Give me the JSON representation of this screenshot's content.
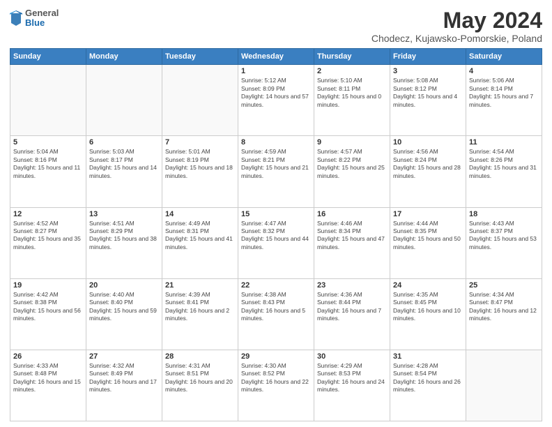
{
  "header": {
    "logo": {
      "general": "General",
      "blue": "Blue"
    },
    "title": "May 2024",
    "subtitle": "Chodecz, Kujawsko-Pomorskie, Poland"
  },
  "weekdays": [
    "Sunday",
    "Monday",
    "Tuesday",
    "Wednesday",
    "Thursday",
    "Friday",
    "Saturday"
  ],
  "weeks": [
    [
      {
        "day": "",
        "sunrise": "",
        "sunset": "",
        "daylight": ""
      },
      {
        "day": "",
        "sunrise": "",
        "sunset": "",
        "daylight": ""
      },
      {
        "day": "",
        "sunrise": "",
        "sunset": "",
        "daylight": ""
      },
      {
        "day": "1",
        "sunrise": "Sunrise: 5:12 AM",
        "sunset": "Sunset: 8:09 PM",
        "daylight": "Daylight: 14 hours and 57 minutes."
      },
      {
        "day": "2",
        "sunrise": "Sunrise: 5:10 AM",
        "sunset": "Sunset: 8:11 PM",
        "daylight": "Daylight: 15 hours and 0 minutes."
      },
      {
        "day": "3",
        "sunrise": "Sunrise: 5:08 AM",
        "sunset": "Sunset: 8:12 PM",
        "daylight": "Daylight: 15 hours and 4 minutes."
      },
      {
        "day": "4",
        "sunrise": "Sunrise: 5:06 AM",
        "sunset": "Sunset: 8:14 PM",
        "daylight": "Daylight: 15 hours and 7 minutes."
      }
    ],
    [
      {
        "day": "5",
        "sunrise": "Sunrise: 5:04 AM",
        "sunset": "Sunset: 8:16 PM",
        "daylight": "Daylight: 15 hours and 11 minutes."
      },
      {
        "day": "6",
        "sunrise": "Sunrise: 5:03 AM",
        "sunset": "Sunset: 8:17 PM",
        "daylight": "Daylight: 15 hours and 14 minutes."
      },
      {
        "day": "7",
        "sunrise": "Sunrise: 5:01 AM",
        "sunset": "Sunset: 8:19 PM",
        "daylight": "Daylight: 15 hours and 18 minutes."
      },
      {
        "day": "8",
        "sunrise": "Sunrise: 4:59 AM",
        "sunset": "Sunset: 8:21 PM",
        "daylight": "Daylight: 15 hours and 21 minutes."
      },
      {
        "day": "9",
        "sunrise": "Sunrise: 4:57 AM",
        "sunset": "Sunset: 8:22 PM",
        "daylight": "Daylight: 15 hours and 25 minutes."
      },
      {
        "day": "10",
        "sunrise": "Sunrise: 4:56 AM",
        "sunset": "Sunset: 8:24 PM",
        "daylight": "Daylight: 15 hours and 28 minutes."
      },
      {
        "day": "11",
        "sunrise": "Sunrise: 4:54 AM",
        "sunset": "Sunset: 8:26 PM",
        "daylight": "Daylight: 15 hours and 31 minutes."
      }
    ],
    [
      {
        "day": "12",
        "sunrise": "Sunrise: 4:52 AM",
        "sunset": "Sunset: 8:27 PM",
        "daylight": "Daylight: 15 hours and 35 minutes."
      },
      {
        "day": "13",
        "sunrise": "Sunrise: 4:51 AM",
        "sunset": "Sunset: 8:29 PM",
        "daylight": "Daylight: 15 hours and 38 minutes."
      },
      {
        "day": "14",
        "sunrise": "Sunrise: 4:49 AM",
        "sunset": "Sunset: 8:31 PM",
        "daylight": "Daylight: 15 hours and 41 minutes."
      },
      {
        "day": "15",
        "sunrise": "Sunrise: 4:47 AM",
        "sunset": "Sunset: 8:32 PM",
        "daylight": "Daylight: 15 hours and 44 minutes."
      },
      {
        "day": "16",
        "sunrise": "Sunrise: 4:46 AM",
        "sunset": "Sunset: 8:34 PM",
        "daylight": "Daylight: 15 hours and 47 minutes."
      },
      {
        "day": "17",
        "sunrise": "Sunrise: 4:44 AM",
        "sunset": "Sunset: 8:35 PM",
        "daylight": "Daylight: 15 hours and 50 minutes."
      },
      {
        "day": "18",
        "sunrise": "Sunrise: 4:43 AM",
        "sunset": "Sunset: 8:37 PM",
        "daylight": "Daylight: 15 hours and 53 minutes."
      }
    ],
    [
      {
        "day": "19",
        "sunrise": "Sunrise: 4:42 AM",
        "sunset": "Sunset: 8:38 PM",
        "daylight": "Daylight: 15 hours and 56 minutes."
      },
      {
        "day": "20",
        "sunrise": "Sunrise: 4:40 AM",
        "sunset": "Sunset: 8:40 PM",
        "daylight": "Daylight: 15 hours and 59 minutes."
      },
      {
        "day": "21",
        "sunrise": "Sunrise: 4:39 AM",
        "sunset": "Sunset: 8:41 PM",
        "daylight": "Daylight: 16 hours and 2 minutes."
      },
      {
        "day": "22",
        "sunrise": "Sunrise: 4:38 AM",
        "sunset": "Sunset: 8:43 PM",
        "daylight": "Daylight: 16 hours and 5 minutes."
      },
      {
        "day": "23",
        "sunrise": "Sunrise: 4:36 AM",
        "sunset": "Sunset: 8:44 PM",
        "daylight": "Daylight: 16 hours and 7 minutes."
      },
      {
        "day": "24",
        "sunrise": "Sunrise: 4:35 AM",
        "sunset": "Sunset: 8:45 PM",
        "daylight": "Daylight: 16 hours and 10 minutes."
      },
      {
        "day": "25",
        "sunrise": "Sunrise: 4:34 AM",
        "sunset": "Sunset: 8:47 PM",
        "daylight": "Daylight: 16 hours and 12 minutes."
      }
    ],
    [
      {
        "day": "26",
        "sunrise": "Sunrise: 4:33 AM",
        "sunset": "Sunset: 8:48 PM",
        "daylight": "Daylight: 16 hours and 15 minutes."
      },
      {
        "day": "27",
        "sunrise": "Sunrise: 4:32 AM",
        "sunset": "Sunset: 8:49 PM",
        "daylight": "Daylight: 16 hours and 17 minutes."
      },
      {
        "day": "28",
        "sunrise": "Sunrise: 4:31 AM",
        "sunset": "Sunset: 8:51 PM",
        "daylight": "Daylight: 16 hours and 20 minutes."
      },
      {
        "day": "29",
        "sunrise": "Sunrise: 4:30 AM",
        "sunset": "Sunset: 8:52 PM",
        "daylight": "Daylight: 16 hours and 22 minutes."
      },
      {
        "day": "30",
        "sunrise": "Sunrise: 4:29 AM",
        "sunset": "Sunset: 8:53 PM",
        "daylight": "Daylight: 16 hours and 24 minutes."
      },
      {
        "day": "31",
        "sunrise": "Sunrise: 4:28 AM",
        "sunset": "Sunset: 8:54 PM",
        "daylight": "Daylight: 16 hours and 26 minutes."
      },
      {
        "day": "",
        "sunrise": "",
        "sunset": "",
        "daylight": ""
      }
    ]
  ]
}
